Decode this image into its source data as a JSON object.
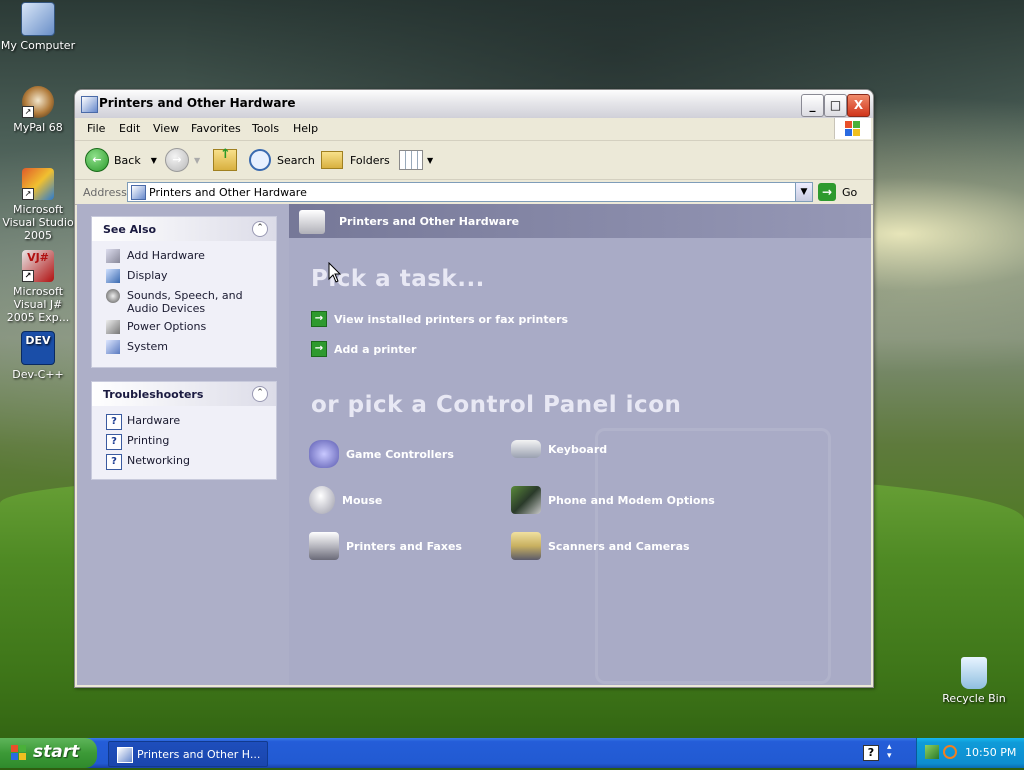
{
  "desktop": {
    "icons": [
      {
        "label": "My Computer",
        "icon": "computer-icon"
      },
      {
        "label": "MyPal 68",
        "icon": "mypal-icon"
      },
      {
        "label": "Microsoft Visual Studio 2005",
        "icon": "visual-studio-icon"
      },
      {
        "label": "Microsoft Visual J# 2005 Exp...",
        "icon": "visual-jsharp-icon"
      },
      {
        "label": "Dev-C++",
        "icon": "devcpp-icon"
      },
      {
        "label": "Recycle Bin",
        "icon": "recycle-bin-icon"
      }
    ],
    "devcpp_badge": "DEV",
    "vj_badge": "VJ#"
  },
  "window": {
    "title": "Printers and Other Hardware",
    "controls": {
      "minimize": "_",
      "maximize": "□",
      "close": "X"
    }
  },
  "menubar": {
    "items": [
      "File",
      "Edit",
      "View",
      "Favorites",
      "Tools",
      "Help"
    ]
  },
  "toolbar": {
    "back": "Back",
    "search": "Search",
    "folders": "Folders"
  },
  "addressbar": {
    "label": "Address",
    "value": "Printers and Other Hardware",
    "go": "Go"
  },
  "leftpane": {
    "see_also": {
      "title": "See Also",
      "items": [
        {
          "label": "Add Hardware",
          "icon": "add-hardware-icon"
        },
        {
          "label": "Display",
          "icon": "display-icon"
        },
        {
          "label": "Sounds, Speech, and Audio Devices",
          "icon": "sounds-icon"
        },
        {
          "label": "Power Options",
          "icon": "power-options-icon"
        },
        {
          "label": "System",
          "icon": "system-icon"
        }
      ]
    },
    "troubleshooters": {
      "title": "Troubleshooters",
      "items": [
        {
          "label": "Hardware",
          "icon": "help-icon"
        },
        {
          "label": "Printing",
          "icon": "help-icon"
        },
        {
          "label": "Networking",
          "icon": "help-icon"
        }
      ]
    }
  },
  "main": {
    "category_title": "Printers and Other Hardware",
    "pick_task": "Pick a task...",
    "tasks": [
      "View installed printers or fax printers",
      "Add a printer"
    ],
    "pick_icon": "or pick a Control Panel icon",
    "icons": [
      {
        "label": "Game Controllers",
        "icon": "game-controller-icon"
      },
      {
        "label": "Keyboard",
        "icon": "keyboard-icon"
      },
      {
        "label": "Mouse",
        "icon": "mouse-icon"
      },
      {
        "label": "Phone and Modem Options",
        "icon": "phone-modem-icon"
      },
      {
        "label": "Printers and Faxes",
        "icon": "printer-icon"
      },
      {
        "label": "Scanners and Cameras",
        "icon": "scanner-camera-icon"
      }
    ]
  },
  "taskbar": {
    "start": "start",
    "task_label": "Printers and Other H...",
    "clock": "10:50 PM",
    "help_glyph": "?"
  },
  "colors": {
    "content_bg": "#a9abc6",
    "taskbar_blue": "#245dd8",
    "start_green": "#3c9a37",
    "tray_blue": "#0f9bd8"
  }
}
